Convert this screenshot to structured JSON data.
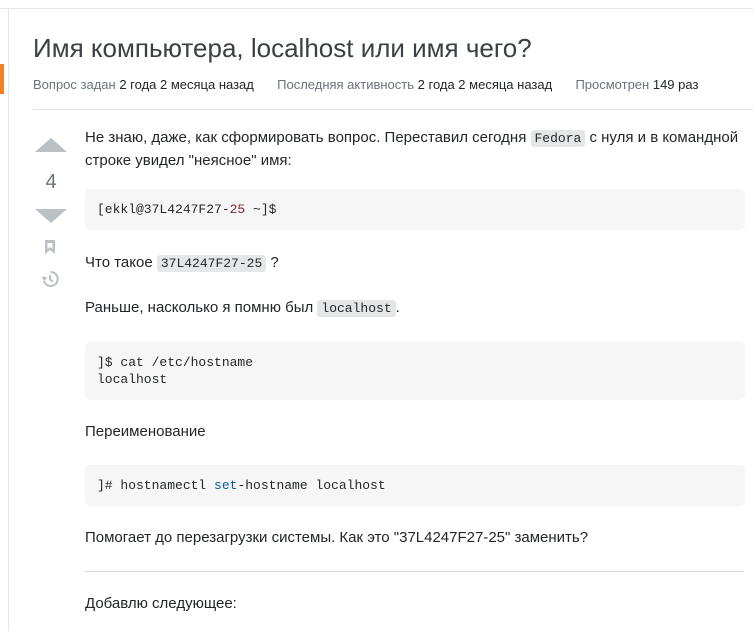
{
  "question": {
    "title": "Имя компьютера, localhost или имя чего?",
    "meta": {
      "asked_label": "Вопрос задан",
      "asked_value": "2 года 2 месяца назад",
      "active_label": "Последняя активность",
      "active_value": "2 года 2 месяца назад",
      "viewed_label": "Просмотрен",
      "viewed_value": "149 раз"
    },
    "vote_count": "4"
  },
  "body": {
    "p1_a": "Не знаю, даже, как сформировать вопрос. Переставил сегодня ",
    "p1_code": "Fedora",
    "p1_b": " с нуля и в командной строке увидел \"неясное\" имя:",
    "code1_prefix": "[ekkl@37L4247F27-",
    "code1_num": "25",
    "code1_suffix": " ~]$",
    "p2_a": "Что такое ",
    "p2_code": "37L4247F27-25",
    "p2_b": " ?",
    "p3_a": "Раньше, насколько я помню был ",
    "p3_code": "localhost",
    "p3_b": ".",
    "code2_line1": "]$ cat /etc/hostname",
    "code2_line2": "localhost",
    "p4": "Переименование",
    "code3_prefix": "]# hostnamectl ",
    "code3_kw": "set",
    "code3_suffix": "-hostname localhost",
    "p5": "Помогает до перезагрузки системы. Как это \"37L4247F27-25\" заменить?",
    "p6": "Добавлю следующее:"
  },
  "icons": {
    "upvote": "arrow-up-icon",
    "downvote": "arrow-down-icon",
    "bookmark": "bookmark-icon",
    "history": "history-icon"
  },
  "colors": {
    "accent": "#f48024",
    "muted": "#6a737c",
    "code_bg": "#f6f6f6",
    "inline_code_bg": "#e4e6e8"
  }
}
